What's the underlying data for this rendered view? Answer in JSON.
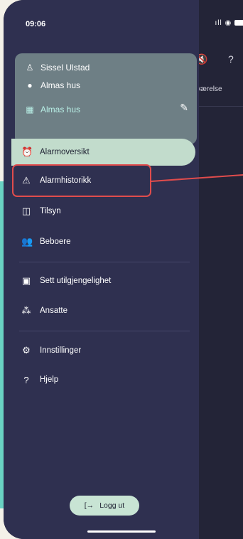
{
  "status_bar": {
    "time": "09:06",
    "signal": "ıll",
    "wifi": "◉"
  },
  "profile": {
    "name": "Sissel Ulstad",
    "location": "Almas hus",
    "unit": "Almas hus"
  },
  "behind": {
    "room_text": "værelse"
  },
  "menu": {
    "items": [
      {
        "label": "Alarmoversikt"
      },
      {
        "label": "Alarmhistorikk"
      },
      {
        "label": "Tilsyn"
      },
      {
        "label": "Beboere"
      },
      {
        "label": "Sett utilgjengelighet"
      },
      {
        "label": "Ansatte"
      },
      {
        "label": "Innstillinger"
      },
      {
        "label": "Hjelp"
      }
    ]
  },
  "logout": {
    "label": "Logg ut"
  },
  "colors": {
    "drawer": "#2f3050",
    "card": "#6e7f85",
    "active": "#c2dccc",
    "highlight": "#e04c4c",
    "teal": "#6ad2c2"
  }
}
